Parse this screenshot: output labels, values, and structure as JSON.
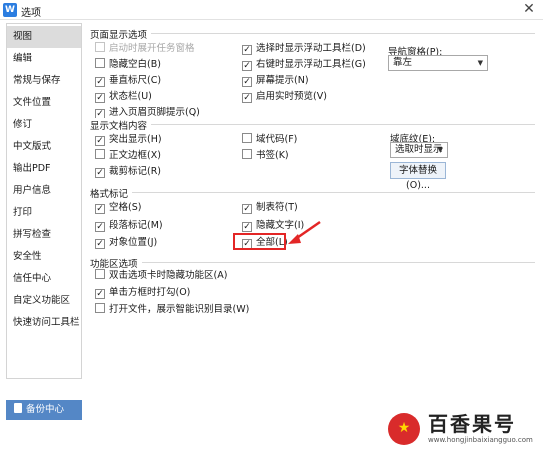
{
  "window": {
    "title": "选项"
  },
  "sidebar": {
    "items": [
      {
        "label": "视图"
      },
      {
        "label": "编辑"
      },
      {
        "label": "常规与保存"
      },
      {
        "label": "文件位置"
      },
      {
        "label": "修订"
      },
      {
        "label": "中文版式"
      },
      {
        "label": "输出PDF"
      },
      {
        "label": "用户信息"
      },
      {
        "label": "打印"
      },
      {
        "label": "拼写检查"
      },
      {
        "label": "安全性"
      },
      {
        "label": "信任中心"
      },
      {
        "label": "自定义功能区"
      },
      {
        "label": "快速访问工具栏"
      }
    ],
    "backup_label": "备份中心"
  },
  "page_display": {
    "title": "页面显示选项",
    "left": [
      {
        "label": "启动时展开任务窗格",
        "checked": false,
        "disabled": true
      },
      {
        "label": "隐藏空白(B)",
        "checked": false
      },
      {
        "label": "垂直标尺(C)",
        "checked": true
      },
      {
        "label": "状态栏(U)",
        "checked": true
      },
      {
        "label": "进入页眉页脚提示(Q)",
        "checked": true
      }
    ],
    "right": [
      {
        "label": "选择时显示浮动工具栏(D)",
        "checked": true
      },
      {
        "label": "右键时显示浮动工具栏(G)",
        "checked": true
      },
      {
        "label": "屏幕提示(N)",
        "checked": true
      },
      {
        "label": "启用实时预览(V)",
        "checked": true
      }
    ],
    "nav_pane_label": "导航窗格(P):",
    "nav_pane_value": "靠左"
  },
  "doc_content": {
    "title": "显示文档内容",
    "items": [
      {
        "label": "突出显示(H)",
        "checked": true
      },
      {
        "label": "域代码(F)",
        "checked": false
      },
      {
        "label": "正文边框(X)",
        "checked": false
      },
      {
        "label": "书签(K)",
        "checked": false
      },
      {
        "label": "裁剪标记(R)",
        "checked": true
      }
    ],
    "field_shading_label": "域底纹(E):",
    "field_shading_value": "选取时显示",
    "font_replace_label": "字体替换(O)..."
  },
  "format_marks": {
    "title": "格式标记",
    "items": [
      {
        "label": "空格(S)",
        "checked": true
      },
      {
        "label": "制表符(T)",
        "checked": true
      },
      {
        "label": "段落标记(M)",
        "checked": true
      },
      {
        "label": "隐藏文字(I)",
        "checked": true
      },
      {
        "label": "对象位置(J)",
        "checked": true
      },
      {
        "label": "全部(L)",
        "checked": true
      }
    ]
  },
  "ribbon": {
    "title": "功能区选项",
    "items": [
      {
        "label": "双击选项卡时隐藏功能区(A)",
        "checked": false
      },
      {
        "label": "单击方框时打勾(O)",
        "checked": true
      },
      {
        "label": "打开文件，展示智能识别目录(W)",
        "checked": false
      }
    ]
  },
  "watermark": {
    "title": "百香果号",
    "url": "www.hongjinbaixiangguo.com"
  },
  "glyphs": {
    "check": "✓",
    "close": "✕",
    "dropdown": "▼"
  },
  "colors": {
    "accent": "#5487c6",
    "annotation": "#e32626",
    "sidebar_active": "#dcdcdc"
  }
}
